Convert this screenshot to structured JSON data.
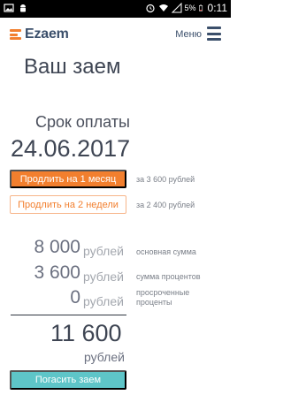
{
  "status_bar": {
    "battery_percent": "5%",
    "time": "0:11",
    "icons": [
      "image-icon",
      "android-icon",
      "alarm-icon",
      "wifi-icon",
      "no-signal-icon",
      "battery-icon"
    ]
  },
  "header": {
    "brand": "Ezaem",
    "menu_label": "Меню",
    "colors": {
      "brand_orange": "#f27f2e",
      "brand_navy": "#3b4f6b"
    }
  },
  "page": {
    "title": "Ваш заем"
  },
  "due": {
    "label": "Срок оплаты",
    "date": "24.06.2017"
  },
  "extensions": [
    {
      "button_label": "Продлить на 1 месяц",
      "price_note": "за 3 600 рублей"
    },
    {
      "button_label": "Продлить на 2 недели",
      "price_note": "за 2 400 рублей"
    }
  ],
  "breakdown": [
    {
      "amount": "8 000",
      "unit": "рублей",
      "description": "основная сумма"
    },
    {
      "amount": "3 600",
      "unit": "рублей",
      "description": "сумма процентов"
    },
    {
      "amount": "0",
      "unit": "рублей",
      "description": "просроченные проценты"
    }
  ],
  "total": {
    "amount": "11 600",
    "unit": "рублей"
  },
  "actions": {
    "pay_label": "Погасить заем"
  },
  "colors": {
    "accent_orange": "#f27f2e",
    "pay_teal": "#5ec5c8"
  }
}
